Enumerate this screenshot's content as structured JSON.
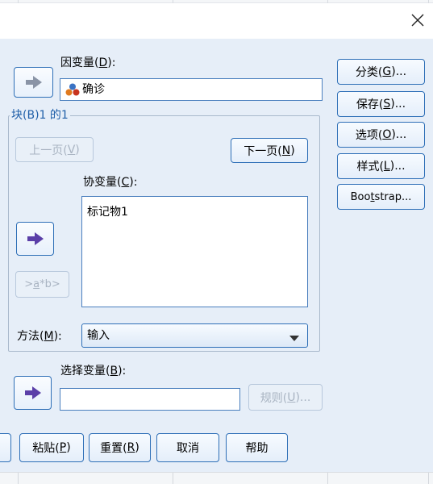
{
  "window": {
    "close_icon": "close-icon"
  },
  "dependent": {
    "label_prefix": "因变量(",
    "label_key": "D",
    "label_suffix": "):",
    "value": "确诊",
    "value_icon": "nominal-measure-icon"
  },
  "block": {
    "legend": "块(B)1 的1",
    "prev_label_prefix": "上一页(",
    "prev_label_key": "V",
    "prev_label_suffix": ")",
    "next_label_prefix": "下一页(",
    "next_label_key": "N",
    "next_label_suffix": ")",
    "covariates_label_prefix": "协变量(",
    "covariates_label_key": "C",
    "covariates_label_suffix": "):",
    "covariates": [
      "标记物1"
    ],
    "interaction_label_a": ">",
    "interaction_label_key": "a",
    "interaction_label_b": "*b>"
  },
  "method": {
    "label_prefix": "方法(",
    "label_key": "M",
    "label_suffix": "):",
    "selected": "输入"
  },
  "selection": {
    "label_prefix": "选择变量(",
    "label_key": "B",
    "label_suffix": "):",
    "value": "",
    "rule_label_prefix": "规则(",
    "rule_label_key": "U",
    "rule_label_suffix": ")..."
  },
  "side_buttons": [
    {
      "prefix": "分类(",
      "key": "G",
      "suffix": ")..."
    },
    {
      "prefix": "保存(",
      "key": "S",
      "suffix": ")..."
    },
    {
      "prefix": "选项(",
      "key": "O",
      "suffix": ")..."
    },
    {
      "prefix": "样式(",
      "key": "L",
      "suffix": ")..."
    },
    {
      "prefix": "Boo",
      "key": "t",
      "suffix": "strap..."
    }
  ],
  "bottom_buttons": [
    {
      "prefix": "粘贴(",
      "key": "P",
      "suffix": ")"
    },
    {
      "prefix": "重置(",
      "key": "R",
      "suffix": ")"
    },
    {
      "prefix": "取消",
      "key": "",
      "suffix": ""
    },
    {
      "prefix": "帮助",
      "key": "",
      "suffix": ""
    }
  ],
  "colors": {
    "dialog_bg": "#e6eef8",
    "button_border": "#2e6fb7",
    "arrow_fill": "#5b3fa8"
  }
}
